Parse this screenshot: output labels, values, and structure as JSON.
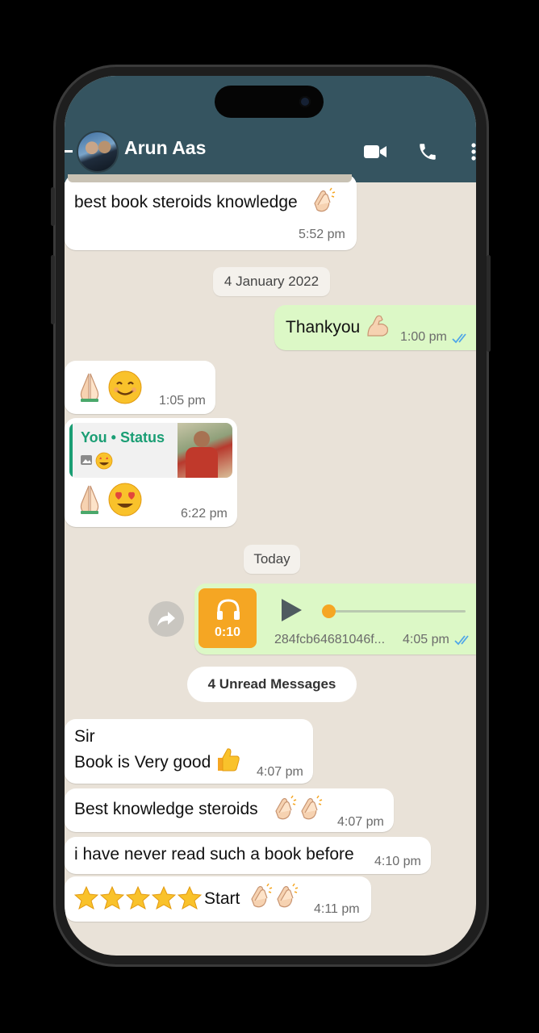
{
  "header": {
    "contact_name": "Arun Aas"
  },
  "messages": {
    "m1": {
      "text": "best book steroids knowledge",
      "time": "5:52 pm"
    },
    "date1": "4 January 2022",
    "m2": {
      "text": "Thankyou",
      "time": "1:00 pm"
    },
    "m3": {
      "time": "1:05 pm"
    },
    "m4": {
      "quote_author": "You",
      "quote_source": "Status",
      "time": "6:22 pm"
    },
    "date2": "Today",
    "m5": {
      "duration": "0:10",
      "filename": "284fcb64681046f...",
      "time": "4:05 pm",
      "progress": 0
    },
    "unread": "4 Unread Messages",
    "m6": {
      "line1": "Sir",
      "line2": "Book is Very good",
      "time": "4:07 pm"
    },
    "m7": {
      "text": "Best knowledge steroids",
      "time": "4:07 pm"
    },
    "m8": {
      "text": "i have never read such a book before",
      "time": "4:10 pm"
    },
    "m9": {
      "text": "Start",
      "time": "4:11 pm"
    }
  },
  "colors": {
    "header": "#355460",
    "outgoing": "#dcf8c6",
    "incoming": "#ffffff",
    "accent": "#f5a623",
    "read_ticks": "#4fa6e8"
  }
}
